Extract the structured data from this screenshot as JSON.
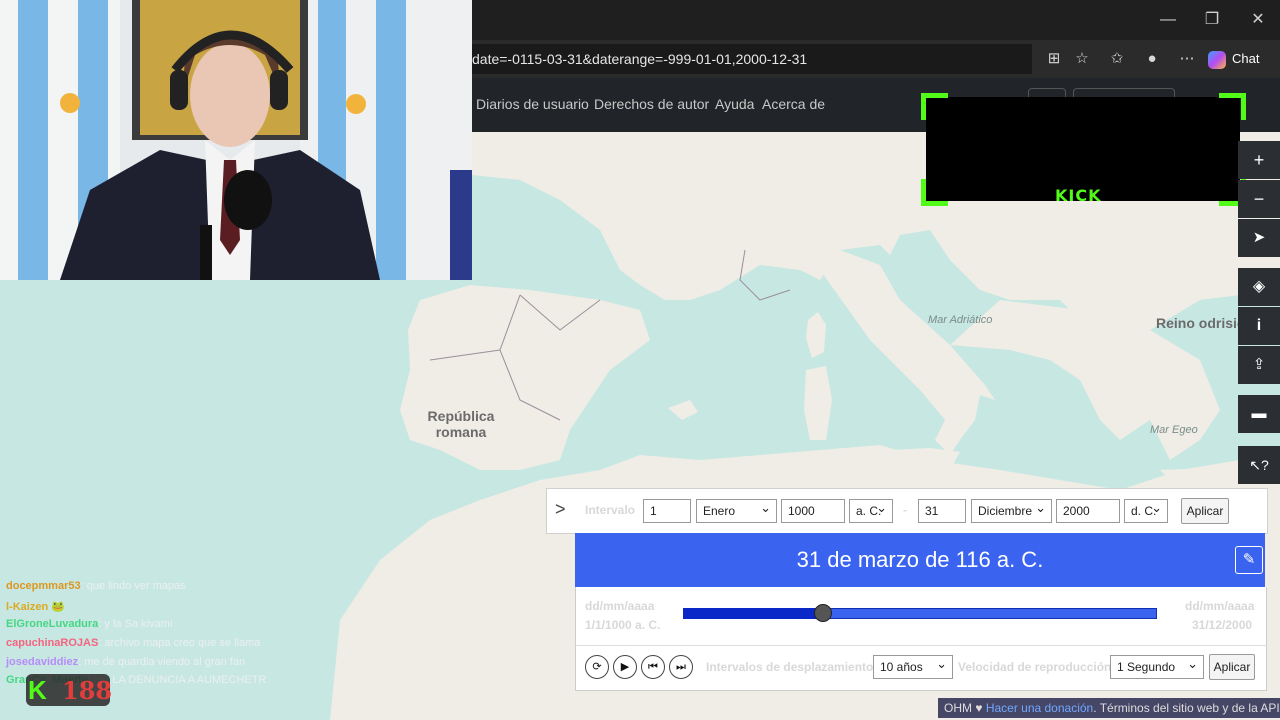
{
  "browser": {
    "url": "date=-0115-03-31&daterange=-999-01-01,2000-12-31",
    "chat_label": "Chat"
  },
  "navbar": {
    "links": [
      "Diarios de usuario",
      "Derechos de autor",
      "Ayuda",
      "Acerca de"
    ]
  },
  "overlay": {
    "kick_label": "KICK",
    "viewer_count": "188"
  },
  "map": {
    "labels": {
      "republica": "República romana",
      "reino": "Reino odrisio",
      "mar_adriatico": "Mar Adriático",
      "mar_egeo": "Mar Egeo"
    }
  },
  "interval": {
    "label": "Intervalo",
    "start_day": "1",
    "start_month": "Enero",
    "start_year": "1000",
    "start_era": "a. C.",
    "separator": "-",
    "end_day": "31",
    "end_month": "Diciembre",
    "end_year": "2000",
    "end_era": "d. C.",
    "apply": "Aplicar"
  },
  "current_date": "31 de marzo de 116 a. C.",
  "slider": {
    "format_hint": "dd/mm/aaaa",
    "start_date": "1/1/1000 a. C.",
    "end_date": "31/12/2000",
    "position_fraction": 0.295
  },
  "controls": {
    "step_label": "Intervalos de desplazamiento",
    "step_value": "10 años",
    "speed_label": "Velocidad de reproducción",
    "speed_value": "1 Segundo",
    "apply": "Aplicar"
  },
  "chat": [
    {
      "user": "docepmmar53",
      "text": "que lindo ver mapas",
      "color": "#e08a00"
    },
    {
      "user": "l-Kaizen",
      "text": "🐸",
      "color": "#e0a000"
    },
    {
      "user": "ElGroneLuvadura",
      "text": "y la Sa kivami",
      "color": "#2ed573"
    },
    {
      "user": "capuchinaROJAS",
      "text": "archivo mapa creo que se llama",
      "color": "#ff4d6d"
    },
    {
      "user": "josedaviddiez",
      "text": "me de quardia viendo al gran fan",
      "color": "#b57bff"
    },
    {
      "user": "GranCa_Muerte",
      "text": "HE LA DENUNCIA A AUMECHETR",
      "color": "#2ed573"
    }
  ],
  "attribution": {
    "ohm": "OHM ♥",
    "donate": "Hacer una donación",
    "terms": "Términos del sitio web y de la API"
  }
}
